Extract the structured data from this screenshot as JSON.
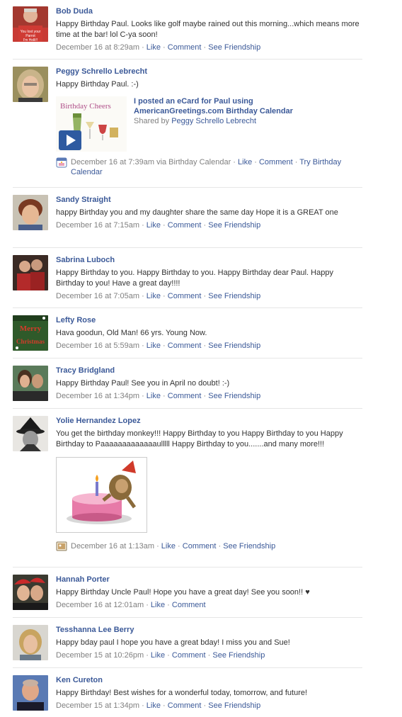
{
  "posts": [
    {
      "author": "Bob Duda",
      "text": "Happy Birthday Paul. Looks like golf maybe rained out this morning...which means more time at the bar! lol C-ya soon!",
      "time": "December 16 at 8:29am",
      "actions": [
        "Like",
        "Comment",
        "See Friendship"
      ],
      "avatar_text": "You lost your Parrot\nI'm Holli!!"
    },
    {
      "author": "Peggy Schrello Lebrecht",
      "text": "Happy Birthday Paul. :-)",
      "attachment": {
        "title_line1": "I posted an eCard for Paul using",
        "title_line2": "AmericanGreetings.com Birthday Calendar",
        "shared_by_prefix": "Shared by ",
        "shared_by": "Peggy Schrello Lebrecht",
        "card_text": "Birthday Cheers"
      },
      "time_prefix": "December 16 at 7:39am via Birthday Calendar",
      "actions": [
        "Like",
        "Comment",
        "Try Birthday Calendar"
      ],
      "icon": "calendar-icon"
    },
    {
      "author": "Sandy Straight",
      "text": "happy Birthday you and my daughter share the same day Hope it is a GREAT one",
      "time": "December 16 at 7:15am",
      "actions": [
        "Like",
        "Comment",
        "See Friendship"
      ]
    },
    {
      "author": "Sabrina Luboch",
      "text": "Happy Birthday to you. Happy Birthday to you. Happy Birthday dear Paul. Happy Birthday to you! Have a great day!!!!",
      "time": "December 16 at 7:05am",
      "actions": [
        "Like",
        "Comment",
        "See Friendship"
      ]
    },
    {
      "author": "Lefty Rose",
      "text": "Hava goodun, Old Man! 66 yrs. Young Now.",
      "time": "December 16 at 5:59am",
      "actions": [
        "Like",
        "Comment",
        "See Friendship"
      ],
      "avatar_text": "Merry Christmas"
    },
    {
      "author": "Tracy Bridgland",
      "text": "Happy Birthday Paul! See you in April no doubt! :-)",
      "time": "December 16 at 1:34pm",
      "actions": [
        "Like",
        "Comment",
        "See Friendship"
      ]
    },
    {
      "author": "Yolie Hernandez Lopez",
      "text": "You get the birthday monkey!!! Happy Birthday to you Happy Birthday to you Happy Birthday to Paaaaaaaaaaaaaulllll Happy Birthday to you.......and many more!!!",
      "time": "December 16 at 1:13am",
      "actions": [
        "Like",
        "Comment",
        "See Friendship"
      ],
      "icon": "photo-icon"
    },
    {
      "author": "Hannah Porter",
      "text": "Happy Birthday Uncle Paul! Hope you have a great day! See you soon!! ♥",
      "time": "December 16 at 12:01am",
      "actions": [
        "Like",
        "Comment"
      ]
    },
    {
      "author": "Tesshanna Lee Berry",
      "text": "Happy bday paul I hope you have a great bday! I miss you and Sue!",
      "time": "December 15 at 10:26pm",
      "actions": [
        "Like",
        "Comment",
        "See Friendship"
      ]
    },
    {
      "author": "Ken Cureton",
      "text": "Happy Birthday! Best wishes for a wonderful today, tomorrow, and future!",
      "time": "December 15 at 1:34pm",
      "actions": [
        "Like",
        "Comment",
        "See Friendship"
      ]
    }
  ],
  "separator": " · ",
  "colors": {
    "link": "#3b5998",
    "meta": "#808080",
    "text": "#333333",
    "divider": "#e6e6e6"
  }
}
